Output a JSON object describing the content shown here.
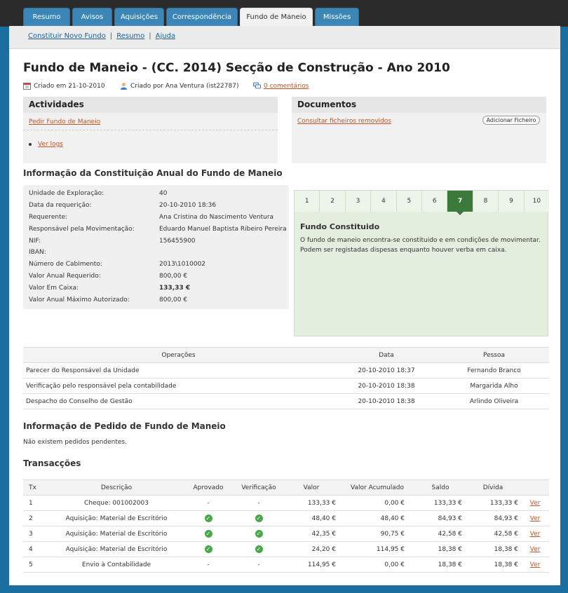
{
  "tabs": [
    {
      "label": "Resumo"
    },
    {
      "label": "Avisos"
    },
    {
      "label": "Aquisições"
    },
    {
      "label": "Correspondência"
    },
    {
      "label": "Fundo de Maneio"
    },
    {
      "label": "Missões"
    }
  ],
  "subnav": {
    "new_fund": "Constituir Novo Fundo",
    "summary": "Resumo",
    "help": "Ajuda",
    "sep": "|"
  },
  "page": {
    "title": "Fundo de Maneio - (CC. 2014) Secção de Construção - Ano 2010",
    "created_on": "Criado em 21-10-2010",
    "created_by": "Criado por Ana Ventura (ist22787)",
    "comments": "0 comentários"
  },
  "activities": {
    "title": "Actividades",
    "request_link": "Pedir Fundo de Maneio",
    "logs_link": "Ver logs"
  },
  "documents": {
    "title": "Documentos",
    "removed_link": "Consultar ficheiros removidos",
    "add_button": "Adicionar Ficheiro"
  },
  "constitution": {
    "title": "Informação da Constituição Anual do Fundo de Maneio",
    "rows": [
      {
        "label": "Unidade de Exploração:",
        "value": "40"
      },
      {
        "label": "Data da requerição:",
        "value": "20-10-2010 18:36"
      },
      {
        "label": "Requerente:",
        "value": "Ana Cristina do Nascimento Ventura"
      },
      {
        "label": "Responsável pela Movimentação:",
        "value": "Eduardo Manuel Baptista Ribeiro Pereira"
      },
      {
        "label": "NIF:",
        "value": "156455900"
      },
      {
        "label": "IBAN:",
        "value": ""
      },
      {
        "label": "Número de Cabimento:",
        "value": "2013\\1010002"
      },
      {
        "label": "Valor Anual Requerido:",
        "value": "800,00 €"
      },
      {
        "label": "Valor Em Caixa:",
        "value": "133,33 €"
      },
      {
        "label": "Valor Anual Máximo Autorizado:",
        "value": "800,00 €"
      }
    ]
  },
  "steps": {
    "numbers": [
      "1",
      "2",
      "3",
      "4",
      "5",
      "6",
      "7",
      "8",
      "9",
      "10"
    ],
    "active_index": 6,
    "title": "Fundo Constituido",
    "description": "O fundo de maneio encontra-se constituido e em condições de movimentar. Podem ser registadas dispesas enquanto houver verba em caixa."
  },
  "operations": {
    "headers": [
      "Operações",
      "Data",
      "Pessoa"
    ],
    "rows": [
      {
        "op": "Parecer do Responsável da Unidade",
        "date": "20-10-2010 18:37",
        "person": "Fernando Branco"
      },
      {
        "op": "Verificação pelo responsável pela contabilidade",
        "date": "20-10-2010 18:38",
        "person": "Margarida Alho"
      },
      {
        "op": "Despacho do Conselho de Gestão",
        "date": "20-10-2010 18:38",
        "person": "Arlindo Oliveira"
      }
    ]
  },
  "requests": {
    "title": "Informação de Pedido de Fundo de Maneio",
    "empty": "Não existem pedidos pendentes."
  },
  "transactions": {
    "title": "Transacções",
    "headers": [
      "Tx",
      "Descrição",
      "Aprovado",
      "Verificação",
      "Valor",
      "Valor Acumulado",
      "Saldo",
      "Dívida",
      ""
    ],
    "rows": [
      {
        "tx": "1",
        "desc": "Cheque: 001002003",
        "approved": "-",
        "verified": "-",
        "value": "133,33 €",
        "acc": "0,00 €",
        "balance": "133,33 €",
        "debt": "133,33 €",
        "link": "Ver"
      },
      {
        "tx": "2",
        "desc": "Aquisição: Material de Escritório",
        "approved": "check",
        "verified": "check",
        "value": "48,40 €",
        "acc": "48,40 €",
        "balance": "84,93 €",
        "debt": "84,93 €",
        "link": "Ver"
      },
      {
        "tx": "3",
        "desc": "Aquisição: Material de Escritório",
        "approved": "check",
        "verified": "check",
        "value": "42,35 €",
        "acc": "90,75 €",
        "balance": "42,58 €",
        "debt": "42,58 €",
        "link": "Ver"
      },
      {
        "tx": "4",
        "desc": "Aquisição: Material de Escritório",
        "approved": "check",
        "verified": "check",
        "value": "24,20 €",
        "acc": "114,95 €",
        "balance": "18,38 €",
        "debt": "18,38 €",
        "link": "Ver"
      },
      {
        "tx": "5",
        "desc": "Envio à Contabilidade",
        "approved": "-",
        "verified": "-",
        "value": "114,95 €",
        "acc": "0,00 €",
        "balance": "18,38 €",
        "debt": "18,38 €",
        "link": "Ver"
      }
    ]
  },
  "colors": {
    "tab_blue": "#3b86b6",
    "active_step": "#3b7a3b",
    "link": "#c0552a",
    "page_bg": "#1a6ea0"
  }
}
